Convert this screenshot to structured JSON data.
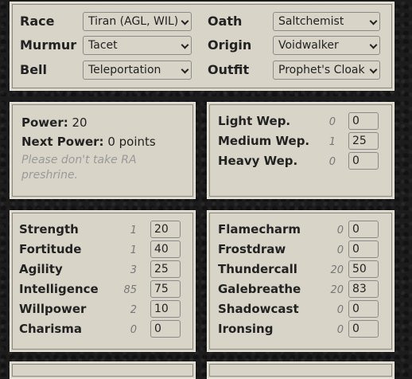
{
  "top": {
    "race": {
      "label": "Race",
      "value": "Tiran (AGL, WIL)"
    },
    "oath": {
      "label": "Oath",
      "value": "Saltchemist"
    },
    "murmur": {
      "label": "Murmur",
      "value": "Tacet"
    },
    "origin": {
      "label": "Origin",
      "value": "Voidwalker"
    },
    "bell": {
      "label": "Bell",
      "value": "Teleportation"
    },
    "outfit": {
      "label": "Outfit",
      "value": "Prophet's Cloak"
    }
  },
  "power": {
    "power_label": "Power:",
    "power_value": "20",
    "next_label": "Next Power:",
    "next_value": "0 points",
    "note": "Please don't take RA preshrine."
  },
  "weapons": [
    {
      "label": "Light Wep.",
      "bonus": "0",
      "value": "0"
    },
    {
      "label": "Medium Wep.",
      "bonus": "1",
      "value": "25"
    },
    {
      "label": "Heavy Wep.",
      "bonus": "0",
      "value": "0"
    }
  ],
  "attributes": [
    {
      "label": "Strength",
      "bonus": "1",
      "value": "20"
    },
    {
      "label": "Fortitude",
      "bonus": "1",
      "value": "40"
    },
    {
      "label": "Agility",
      "bonus": "3",
      "value": "25"
    },
    {
      "label": "Intelligence",
      "bonus": "85",
      "value": "75"
    },
    {
      "label": "Willpower",
      "bonus": "2",
      "value": "10"
    },
    {
      "label": "Charisma",
      "bonus": "0",
      "value": "0"
    }
  ],
  "attunements": [
    {
      "label": "Flamecharm",
      "bonus": "0",
      "value": "0"
    },
    {
      "label": "Frostdraw",
      "bonus": "0",
      "value": "0"
    },
    {
      "label": "Thundercall",
      "bonus": "20",
      "value": "50"
    },
    {
      "label": "Galebreathe",
      "bonus": "20",
      "value": "83"
    },
    {
      "label": "Shadowcast",
      "bonus": "0",
      "value": "0"
    },
    {
      "label": "Ironsing",
      "bonus": "0",
      "value": "0"
    }
  ]
}
